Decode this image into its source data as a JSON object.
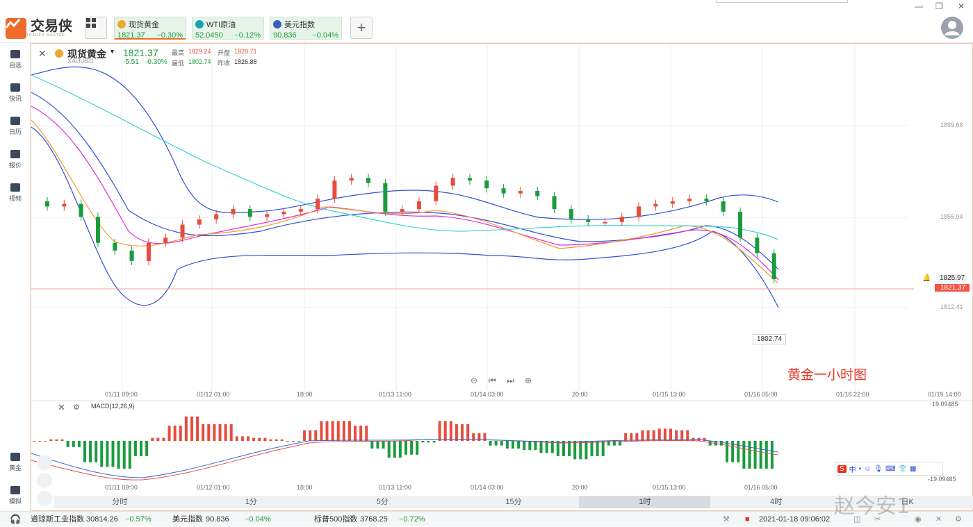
{
  "app": {
    "logo_text": "交易侠",
    "logo_sub": "TRADER MASTER"
  },
  "tickers": [
    {
      "name": "现货黄金",
      "price": "1821.37",
      "change": "−0.30%",
      "icon_color": "#f0a830"
    },
    {
      "name": "WTI原油",
      "price": "52.0450",
      "change": "−0.12%",
      "icon_color": "#1aa0b8"
    },
    {
      "name": "美元指数",
      "price": "90.836",
      "change": "−0.04%",
      "icon_color": "#3a5ec0"
    }
  ],
  "sidebar": [
    {
      "label": "自选",
      "icon": "bookmark-icon"
    },
    {
      "label": "快讯",
      "icon": "news-icon"
    },
    {
      "label": "日历",
      "icon": "calendar-icon"
    },
    {
      "label": "报价",
      "icon": "quote-icon"
    },
    {
      "label": "视频",
      "icon": "video-icon"
    },
    {
      "label": "黄金",
      "icon": "gold-icon"
    },
    {
      "label": "模拟",
      "icon": "simulate-icon"
    }
  ],
  "symbol": {
    "name": "现货黄金",
    "code": "XAUUSD",
    "price": "1821.37",
    "change": "-5.51",
    "change_pct": "-0.30%",
    "high_label": "最高",
    "high": "1829.24",
    "open_label": "开盘",
    "open": "1828.71",
    "low_label": "最低",
    "low": "1802.74",
    "prev_label": "昨收",
    "prev": "1826.88"
  },
  "price_axis": [
    "1899.68",
    "1856.04",
    "1812.41"
  ],
  "price_tags": {
    "alert": "1825.97",
    "current": "1821.37",
    "low_marker": "1802.74"
  },
  "annotation": "黄金一小时图",
  "time_axis": [
    "01/11 09:00",
    "01/12 01:00",
    "18:00",
    "01/13 11:00",
    "01/14 03:00",
    "20:00",
    "01/15 13:00",
    "01/16 05:00",
    "01/18 22:00",
    "01/19 14:00"
  ],
  "macd": {
    "label": "MACD(12,26,9)",
    "axis_top": "19.09485",
    "axis_bottom": "-19.09485"
  },
  "periods": [
    {
      "label": "分时",
      "active": false
    },
    {
      "label": "1分",
      "active": false
    },
    {
      "label": "5分",
      "active": false
    },
    {
      "label": "15分",
      "active": false
    },
    {
      "label": "1时",
      "active": true
    },
    {
      "label": "4时",
      "active": false
    },
    {
      "label": "日K",
      "active": false
    }
  ],
  "status": {
    "items": [
      {
        "name": "道琼斯工业指数",
        "value": "30814.26",
        "change": "−0.57%"
      },
      {
        "name": "美元指数",
        "value": "90.836",
        "change": "−0.04%"
      },
      {
        "name": "标普500指数",
        "value": "3768.25",
        "change": "−0.72%"
      }
    ],
    "datetime": "2021-01-18 09:06:02"
  },
  "watermark": "赵今安1",
  "colors": {
    "up": "#e74c3c",
    "down": "#1a9c3c",
    "accent": "#f06a2b"
  },
  "chart_data": {
    "type": "line",
    "title": "",
    "candles_close": [
      1850,
      1851,
      1846,
      1836,
      1833,
      1829,
      1836,
      1838,
      1843,
      1845,
      1847,
      1849,
      1846,
      1847,
      1848,
      1849,
      1853,
      1860,
      1861,
      1859,
      1848,
      1849,
      1852,
      1858,
      1861,
      1860,
      1857,
      1855,
      1856,
      1854,
      1849,
      1845,
      1844,
      1844,
      1846,
      1850,
      1851,
      1852,
      1853,
      1852,
      1848,
      1838,
      1832,
      1822
    ],
    "ylim": [
      1795,
      1910
    ]
  }
}
